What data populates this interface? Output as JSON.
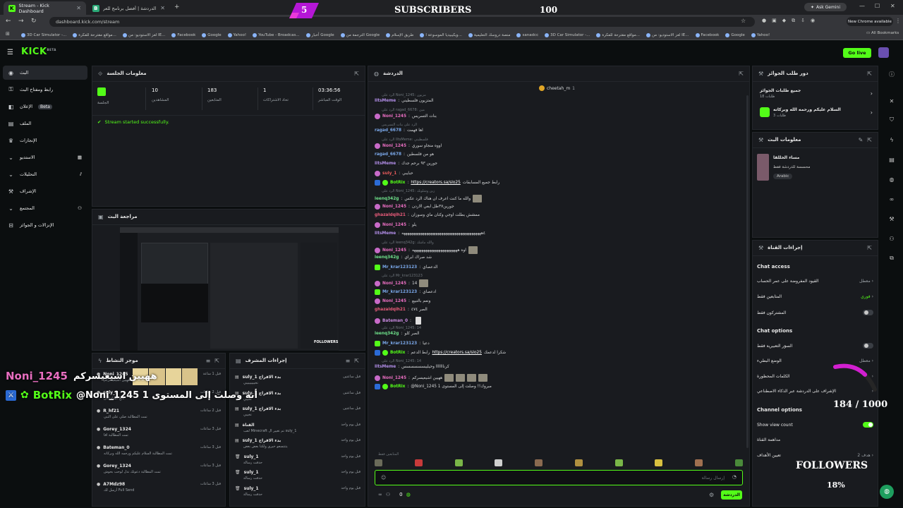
{
  "browser": {
    "tabs": [
      {
        "title": "Stream - Kick Dashboard",
        "icon": "K"
      },
      {
        "title": "بوت الدردشة | أفضل برنامج للعر...",
        "icon": "B"
      }
    ],
    "url": "dashboard.kick.com/stream",
    "ask_gemini": "Ask Gemini",
    "new_chrome": "New Chrome available",
    "bookmarks": [
      "3D Car Simulator -...",
      "مواقع مقترحة للفكرة...",
      "لغز الاستوديو: من IE...",
      "Facebook",
      "Google",
      "Yahoo!",
      "YouTube - Broadcas...",
      "أخبار Google",
      "الترجمة من Google",
      "طريق الإسلام",
      "ويكيبيديا الموسوعة ا...",
      "منصة دروسك التعليمية",
      "sanadcc",
      "3D Car Simulator -...",
      "مواقع مقترحة للفكرة...",
      "لغز الاستوديو: من IE...",
      "Facebook",
      "Google",
      "Yahoo!"
    ],
    "all_bookmarks": "All Bookmarks"
  },
  "overlay": {
    "subs_count": "5",
    "subs_label": "SUBSCRIBERS",
    "subs_goal": "100",
    "followers_progress": "184 / 1000",
    "followers_label": "FOLLOWERS",
    "followers_pct": "18%",
    "followers_fraction": 0.184,
    "alert_line1_name": "Noni_1245",
    "alert_line1_text": "ههيين اشيعيسركم",
    "alert_line2_name": "BotRix",
    "alert_line2_text": "@Noni_1245 أنه وصلت إلى المستوى 1"
  },
  "nav": {
    "logo": "KICK",
    "logo_sup": "BETA",
    "go_live": "Go live"
  },
  "sidebar": {
    "items": [
      {
        "label": "البث",
        "icon": "broadcast-icon"
      },
      {
        "label": "رابط ومفتاح البث",
        "icon": "key-icon"
      },
      {
        "label": "الإعلان",
        "icon": "megaphone-icon",
        "badge": "Beta"
      },
      {
        "label": "الملف",
        "icon": "file-icon"
      },
      {
        "label": "الإنجازات",
        "icon": "trophy-icon"
      },
      {
        "label": "الاستديو",
        "icon": "studio-icon"
      },
      {
        "label": "التحليلات",
        "icon": "chart-icon"
      },
      {
        "label": "الإشراف",
        "icon": "wrench-icon"
      },
      {
        "label": "المجتمع",
        "icon": "users-icon"
      },
      {
        "label": "الإنزالات و الجوائز",
        "icon": "gift-icon"
      }
    ]
  },
  "session": {
    "title": "معلومات الجلسة",
    "stats": [
      {
        "value": "",
        "label": "الجلسة"
      },
      {
        "value": "10",
        "label": "المشاهدين"
      },
      {
        "value": "183",
        "label": "المتابعين"
      },
      {
        "value": "1",
        "label": "تحاد الاشتراكات"
      },
      {
        "value": "03:36:56",
        "label": "الوقت المباشر"
      }
    ],
    "status": "Stream started successfully."
  },
  "preview": {
    "title": "مراجعة البث",
    "followers": "FOLLOWERS"
  },
  "activity": {
    "title": "موجز النشاط",
    "rows": [
      {
        "name": "Noni_1245",
        "sub": "ههيين اشيعيسركم",
        "time": "قبل 1 ساعة"
      },
      {
        "name": "suly_1",
        "sub": "تابع القناة الآن",
        "time": "قبل 2 ساعات"
      },
      {
        "name": "R_hf21",
        "sub": "تمت المطالبة صلي على النبي",
        "time": "قبل 2 ساعات"
      },
      {
        "name": "Gorey_1324",
        "sub": "تمت المطالبة اقا",
        "time": "قبل 3 ساعات"
      },
      {
        "name": "Bateman_0",
        "sub": "تمت المطالبة السلام عليكم ورحمه الله وبركاته",
        "time": "قبل 3 ساعات"
      },
      {
        "name": "Gorey_1324",
        "sub": "تمت المطالبة دعوتك تدل لوحب بحوش",
        "time": "قبل 3 ساعات"
      },
      {
        "name": "A7Mdz98",
        "sub": "أرسل لك Full Send",
        "time": "قبل 3 ساعات"
      }
    ]
  },
  "mod": {
    "title": "إجراءات المشرف",
    "rows": [
      {
        "name": "suly_1 بدء الافراج",
        "sub": "تخييييييييي",
        "time": "قبل ساعتين"
      },
      {
        "name": "suly_1 بدء الافراج",
        "sub": "تخييي",
        "time": "قبل ساعتين"
      },
      {
        "name": "suly_1 بدء الافراج",
        "sub": "تخييي",
        "time": "قبل ساعتين"
      },
      {
        "name": "القناة",
        "sub": "لعب Minecraft تم تغيير ال suly_1",
        "time": "قبل يوم واحد"
      },
      {
        "name": "suly_1 بدء الافراج",
        "sub": "يتتتسعو خيري ولكنا بعض بعض",
        "time": "قبل يوم واحد"
      },
      {
        "name": "suly_1",
        "sub": "حذفت رسالة",
        "time": "قبل يوم واحد"
      },
      {
        "name": "suly_1",
        "sub": "حذفت رسالة",
        "time": "قبل يوم واحد"
      },
      {
        "name": "suly_1",
        "sub": "حذفت رسالة",
        "time": "قبل يوم واحد"
      }
    ]
  },
  "chat": {
    "title": "الدردشة",
    "pinned_user": "cheetah_m",
    "pinned_count": "1",
    "lines": [
      {
        "reply": "الرد على Noni_1245: مزيون",
        "user": "IItsMeme",
        "color": "#b28ee8",
        "text": "المتزيون فلسطيني"
      },
      {
        "reply": "الرد على ragad_6678: مين",
        "user": "Noni_1245",
        "color": "#e86ec0",
        "text": "بنات التسريس"
      },
      {
        "reply": "الرد على بنات التسريس",
        "user": "ragad_6678",
        "color": "#7aa7e8",
        "text": "اها فهمت"
      },
      {
        "reply": "الرد على IItsMeme: فلسطيني",
        "user": "Noni_1245",
        "color": "#e86ec0",
        "text": "اووه منجاو سوري"
      },
      {
        "reply": "",
        "user": "ragad_6678",
        "color": "#7aa7e8",
        "text": "هو من فلسطين"
      },
      {
        "reply": "",
        "user": "IItsMeme",
        "color": "#b28ee8",
        "text": "جورين ٩٣ برحم جدك"
      },
      {
        "reply": "",
        "user": "suly_1",
        "color": "#e85b5b",
        "text": "حبايبي"
      },
      {
        "reply": "",
        "user": "BotRix",
        "color": "#53fc18",
        "text": "رابط جميع المسابقات",
        "link": "https://creators.sa/slo25"
      },
      {
        "reply": "الرد على Noni_1245: زين وشلونك",
        "user": "leenq342g",
        "color": "#6ee08a",
        "text": "والله ما كنت اعرف ان هناك الرد عكس"
      },
      {
        "reply": "",
        "user": "Noni_1245",
        "color": "#e86ec0",
        "text": "جورين٣٧طل ابغي الاردن"
      },
      {
        "reply": "",
        "user": "ghazaldqih21",
        "color": "#e85b7a",
        "text": "ممشش بطلت اوجي وكنان ماي وسوزان"
      },
      {
        "reply": "",
        "user": "Noni_1245",
        "color": "#e86ec0",
        "text": "يلو"
      },
      {
        "reply": "",
        "user": "IItsMeme",
        "color": "#b28ee8",
        "text": "٤ههههههههههههههههههههههههههههههههههههههههههه"
      },
      {
        "reply": "الرد على leenq342g: والله ماشك",
        "user": "Noni_1245",
        "color": "#e86ec0",
        "text": "اوه ههههههههههههههههههههههههه"
      },
      {
        "reply": "",
        "user": "leenq342g",
        "color": "#6ee08a",
        "text": "شد صراك ابراي"
      },
      {
        "reply": "",
        "user": "Mr_krar123123",
        "color": "#7aa7e8",
        "text": "الدعصاي"
      },
      {
        "reply": "الرد على Mr_krar123123",
        "user": "Noni_1245",
        "color": "#e86ec0",
        "text": "14"
      },
      {
        "reply": "",
        "user": "Mr_krar123123",
        "color": "#7aa7e8",
        "text": "ادعصاي"
      },
      {
        "reply": "",
        "user": "Noni_1245",
        "color": "#e86ec0",
        "text": "ونعم بالتبيع"
      },
      {
        "reply": "",
        "user": "ghazaldqih21",
        "color": "#e85b7a",
        "text": "الصر ٤٧٤"
      },
      {
        "reply": "",
        "user": "Bateman_0",
        "color": "#c98ae0",
        "text": ""
      },
      {
        "reply": "الرد على Noni_1245: 14",
        "user": "leenq342g",
        "color": "#6ee08a",
        "text": "الصر كلو"
      },
      {
        "reply": "",
        "user": "Mr_krar123123",
        "color": "#7aa7e8",
        "text": "دعيا"
      },
      {
        "reply": "",
        "user": "BotRix",
        "color": "#53fc18",
        "text": "شكرا لدعمك",
        "link": "https://creators.sa/slo25",
        "prefix": "رابط الدعم"
      },
      {
        "reply": "الرد على Noni_1245: 14",
        "user": "IItsMeme",
        "color": "#b28ee8",
        "text": "كرنااااااا وحيليبسسسسسس"
      },
      {
        "reply": "",
        "user": "Noni_1245",
        "color": "#e86ec0",
        "text": "ههيين اشيعيسركم"
      },
      {
        "reply": "",
        "user": "BotRix",
        "color": "#53fc18",
        "text": "@Noni_1245 مبروك!! وصلت إلى المستوى 1"
      }
    ],
    "followers_only": "المتابعين فقط",
    "input_placeholder": "إرسال رسالة",
    "viewers": "0",
    "send": "الدردشة"
  },
  "rewards": {
    "title": "دور طلب الجوائز",
    "rows": [
      {
        "title": "جميع طلبات الجوائز",
        "sub": "طلبات 18"
      },
      {
        "title": "السلام عليكم ورحمه الله وبركاته",
        "sub": "طلبات 3"
      }
    ]
  },
  "stream_info": {
    "title": "معلومات البث",
    "name": "مساء الخللقا",
    "category": "محسسة للدردشة فقط",
    "lang": "Arabic"
  },
  "channel": {
    "title": "إجراءات القناة",
    "chat_access": "Chat access",
    "access_rows": [
      {
        "label": "القيود المفروضة على عمر الحساب",
        "value": "معطل"
      },
      {
        "label": "المتابعين فقط",
        "value": "فوري"
      },
      {
        "label": "المشتركون فقط",
        "value": ""
      }
    ],
    "chat_options": "Chat options",
    "option_rows": [
      {
        "label": "السوَر التعبيرية فقط",
        "value": ""
      },
      {
        "label": "الوضع البطيء",
        "value": "معطل"
      },
      {
        "label": "الكلمات المحظورة",
        "value": ""
      },
      {
        "label": "الإشراف على الدردشة عبر الذكاء الاصطناعي",
        "value": ""
      }
    ],
    "channel_options": "Channel options",
    "show_view_count": "Show view count",
    "raid": "مداهمة القناة",
    "goals": "تعيين الأهداف",
    "goals_sub": "هدف 2"
  },
  "colors": {
    "accent": "#53fc18",
    "panel": "#191b1f",
    "bg": "#0b0e0f"
  }
}
